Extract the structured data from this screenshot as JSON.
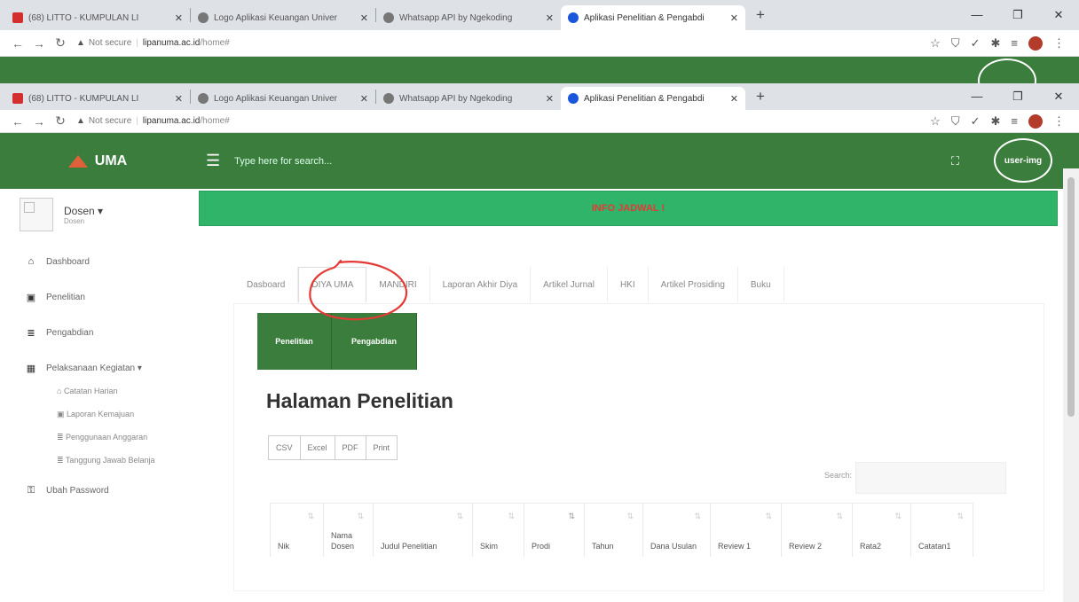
{
  "browser": {
    "tabs": [
      {
        "title": "(68) LITTO - KUMPULAN LI",
        "favicon_color": "#d32f2f",
        "extra": "🔊"
      },
      {
        "title": "Logo Aplikasi Keuangan Univer",
        "favicon_color": "#555555"
      },
      {
        "title": "Whatsapp API by Ngekoding",
        "favicon_color": "#555555"
      },
      {
        "title": "Aplikasi Penelitian & Pengabdi",
        "favicon_color": "#1a56db",
        "active": true
      }
    ],
    "url_warning": "Not secure",
    "url_host": "lipanuma.ac.id",
    "url_path": "/home#"
  },
  "header": {
    "brand": "UMA",
    "search_placeholder": "Type here for search...",
    "user_label": "user-img"
  },
  "sidebar": {
    "user_name": "Dosen ▾",
    "user_role": "Dosen",
    "items": [
      {
        "label": "Dashboard",
        "icon": "home-icon"
      },
      {
        "label": "Penelitian",
        "icon": "file-icon"
      },
      {
        "label": "Pengabdian",
        "icon": "list-icon"
      },
      {
        "label": "Pelaksanaan Kegiatan ▾",
        "icon": "grid-icon"
      }
    ],
    "subitems": [
      "Catatan Harian",
      "Laporan Kemajuan",
      "Penggunaan Anggaran",
      "Tanggung Jawab Belanja"
    ],
    "password": "Ubah Password"
  },
  "main": {
    "info": "INFO JADWAL !",
    "tabs": [
      "Dasboard",
      "DIYA UMA",
      "MANDIRI",
      "Laporan Akhir Diya",
      "Artikel Jurnal",
      "HKI",
      "Artikel Prosiding",
      "Buku"
    ],
    "active_tab": "DIYA UMA",
    "btn_penelitian": "Penelitian",
    "btn_pengabdian": "Pengabdian",
    "heading": "Halaman Penelitian",
    "export": [
      "CSV",
      "Excel",
      "PDF",
      "Print"
    ],
    "search_label": "Search:",
    "columns": [
      "Nik",
      "Nama Dosen",
      "Judul Penelitian",
      "Skim",
      "Prodi",
      "Tahun",
      "Dana Usulan",
      "Review 1",
      "Review 2",
      "Rata2",
      "Catatan1"
    ]
  }
}
